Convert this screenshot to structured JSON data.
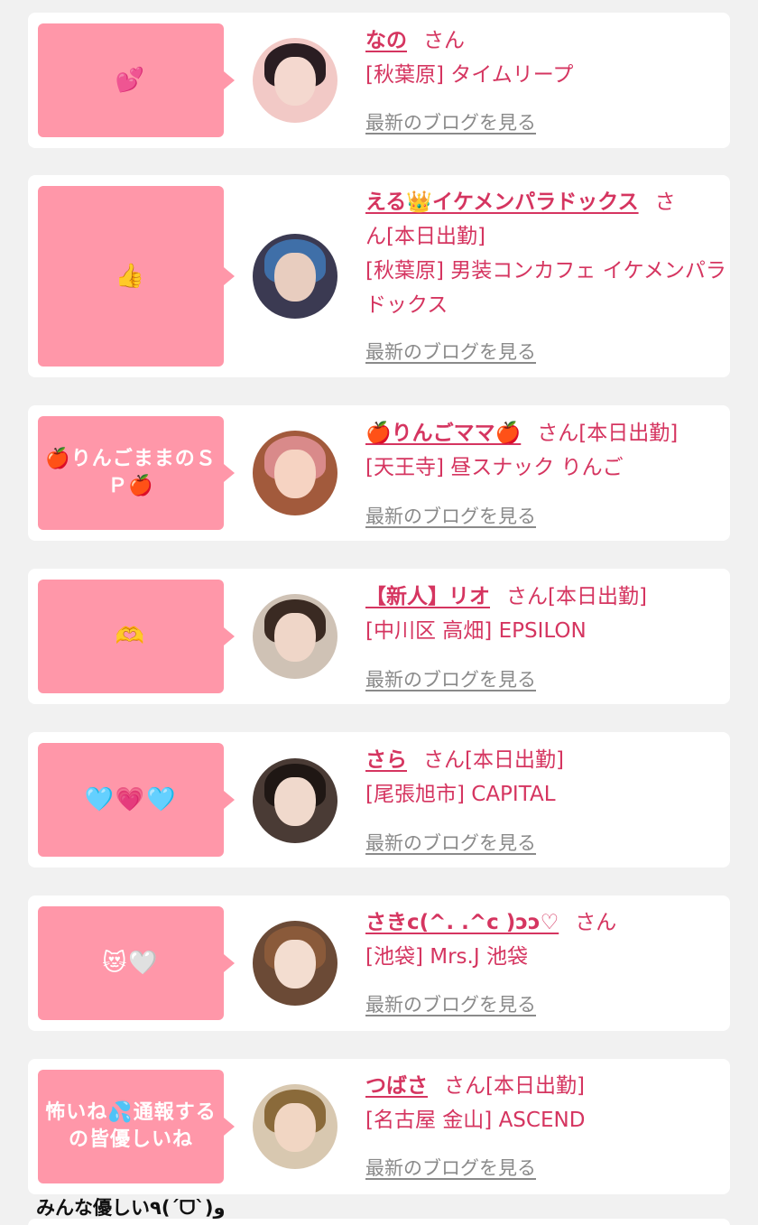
{
  "posts": [
    {
      "bubble_text": "💕",
      "name": "なの",
      "honorific": "さん",
      "status": "",
      "shop": "[秋葉原] タイムリープ",
      "blog_link": "最新のブログを見る",
      "avatar_colors": {
        "bg": "#f2c9c6",
        "hair": "#2a1d22",
        "skin": "#f4d8cf"
      }
    },
    {
      "bubble_text": "👍",
      "name": "える👑イケメンパラドックス",
      "honorific": "さ",
      "status": "ん[本日出勤]",
      "shop": "[秋葉原] 男装コンカフェ イケメンパラドックス",
      "blog_link": "最新のブログを見る",
      "avatar_colors": {
        "bg": "#3b3a52",
        "hair": "#3f6fa8",
        "skin": "#e8cdbf"
      }
    },
    {
      "bubble_text": "🍎りんごままのＳＰ🍎",
      "name": "🍎りんごママ🍎",
      "honorific": "さん",
      "status": "[本日出勤]",
      "shop": "[天王寺] 昼スナック りんご",
      "blog_link": "最新のブログを見る",
      "avatar_colors": {
        "bg": "#a25a3c",
        "hair": "#d98a8a",
        "skin": "#f6d3c2"
      }
    },
    {
      "bubble_text": "🫶",
      "name": "【新人】リオ",
      "honorific": "さん",
      "status": "[本日出勤]",
      "shop": "[中川区 高畑] EPSILON",
      "blog_link": "最新のブログを見る",
      "avatar_colors": {
        "bg": "#cfc2b5",
        "hair": "#3a2a22",
        "skin": "#efd6c8"
      }
    },
    {
      "bubble_text": "🩵💗🩵",
      "name": "さら",
      "honorific": "さん",
      "status": "[本日出勤]",
      "shop": "[尾張旭市] CAPITAL",
      "blog_link": "最新のブログを見る",
      "avatar_colors": {
        "bg": "#4a3b35",
        "hair": "#1f1714",
        "skin": "#f0d9cc"
      }
    },
    {
      "bubble_text": "😻🤍",
      "name": "さきc(^. .^c )ɔɔ♡",
      "honorific": "さん",
      "status": "",
      "shop": "[池袋] Mrs.J 池袋",
      "blog_link": "最新のブログを見る",
      "avatar_colors": {
        "bg": "#6b4a36",
        "hair": "#8a5a3a",
        "skin": "#f3ddd0"
      }
    },
    {
      "bubble_text": "怖いね💦通報するの皆優しいね",
      "name": "つばさ",
      "honorific": "さん",
      "status": "[本日出勤]",
      "shop": "[名古屋 金山] ASCEND",
      "blog_link": "最新のブログを見る",
      "avatar_colors": {
        "bg": "#d8c8b0",
        "hair": "#8a6a3a",
        "skin": "#f1d6c3"
      }
    }
  ],
  "footer_note": "みんな優しい٩(ˊᗜˋ)و"
}
